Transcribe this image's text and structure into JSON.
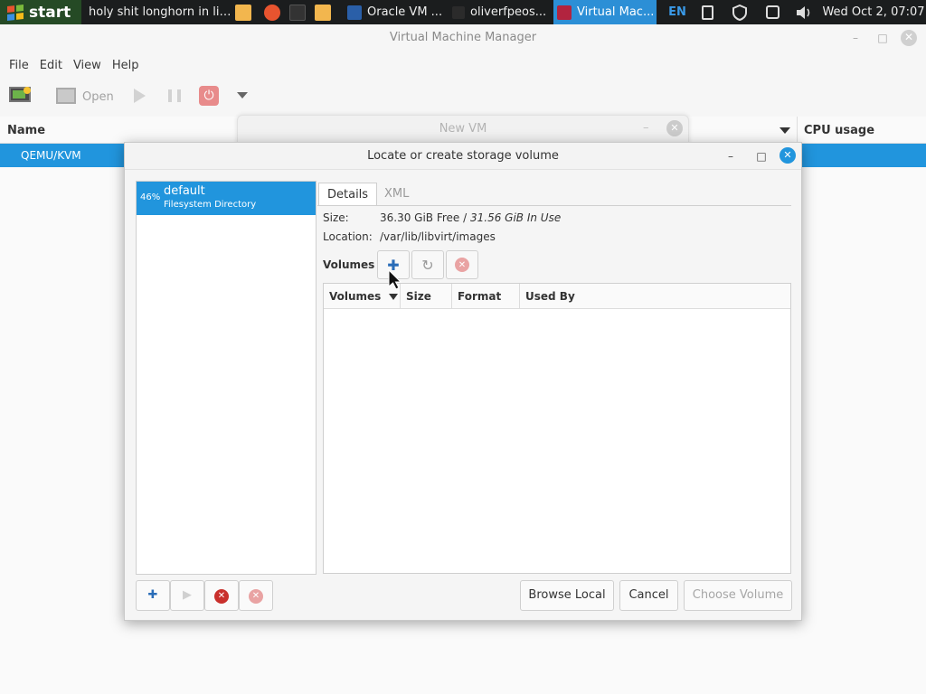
{
  "taskbar": {
    "start_label": "start",
    "items": [
      {
        "label": "holy shit longhorn in linux"
      },
      {
        "label": "Oracle VM ..."
      },
      {
        "label": "oliverfpeos..."
      },
      {
        "label": "Virtual Mac..."
      }
    ],
    "language": "EN",
    "clock": "Wed Oct  2, 07:07"
  },
  "main_window": {
    "title": "Virtual Machine Manager",
    "menu": [
      "File",
      "Edit",
      "View",
      "Help"
    ],
    "toolbar": {
      "open_label": "Open"
    },
    "list_header": {
      "name": "Name",
      "cpu": "CPU usage"
    },
    "connection": "QEMU/KVM"
  },
  "ghost_dialog": {
    "title": "New VM"
  },
  "dialog": {
    "title": "Locate or create storage volume",
    "pool": {
      "percent": "46%",
      "name": "default",
      "type": "Filesystem Directory"
    },
    "tabs": [
      "Details",
      "XML"
    ],
    "details": {
      "size_label": "Size:",
      "size_free": "36.30 GiB Free / ",
      "size_used": "31.56 GiB In Use",
      "location_label": "Location:",
      "location_value": "/var/lib/libvirt/images",
      "volumes_label": "Volumes"
    },
    "table_columns": [
      "Volumes",
      "Size",
      "Format",
      "Used By"
    ],
    "buttons": {
      "browse": "Browse Local",
      "cancel": "Cancel",
      "choose": "Choose Volume"
    }
  },
  "colors": {
    "accent": "#2195dd",
    "danger": "#c9302c",
    "taskbar": "#1b1d1e"
  }
}
